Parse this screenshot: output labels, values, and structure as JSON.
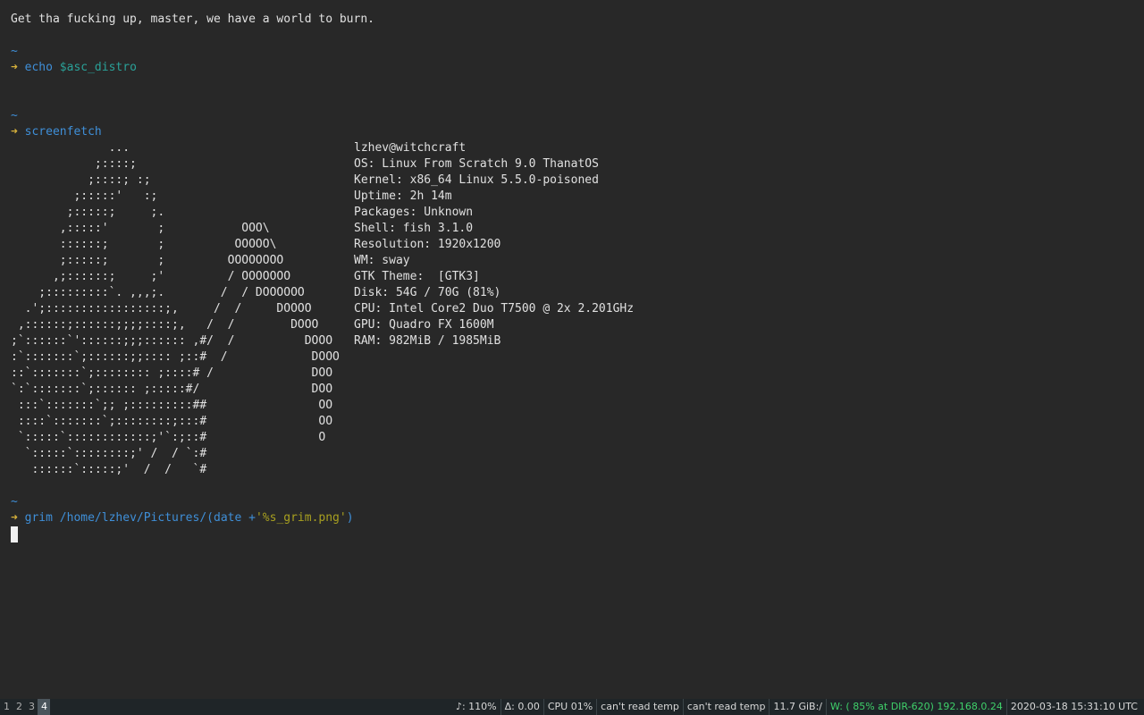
{
  "terminal": {
    "greeting": "Get tha fucking up, master, we have a world to burn.",
    "prompt": {
      "tilde": "~",
      "arrow": "➜"
    },
    "commands": {
      "echo": {
        "name": "echo",
        "arg": "$asc_distro"
      },
      "screenfetch": {
        "name": "screenfetch"
      },
      "grim": {
        "name": "grim",
        "path": "/home/lzhev/Pictures/",
        "paren_open": "(",
        "date_cmd": "date",
        "plus": "+",
        "format": "'%s_grim.png'",
        "paren_close": ")"
      }
    },
    "ascii_art": [
      "              ...",
      "            ;::::;",
      "           ;::::; :;",
      "         ;:::::'   :;",
      "        ;:::::;     ;.",
      "       ,:::::'       ;           OOO\\",
      "       ::::::;       ;          OOOOO\\",
      "       ;:::::;       ;         OOOOOOOO",
      "      ,;::::::;     ;'         / OOOOOOO",
      "    ;:::::::::`. ,,,;.        /  / DOOOOOO",
      "  .';:::::::::::::::::;,     /  /     DOOOO",
      " ,::::::;::::::;;;;::::;,   /  /        DOOO",
      ";`::::::`'::::::;;;:::::: ,#/  /          DOOO",
      ":`:::::::`;::::::;;:::: ;::#  /            DOOO",
      "::`:::::::`;:::::::: ;::::# /              DOO",
      "`:`:::::::`;:::::: ;:::::#/                DOO",
      " :::`:::::::`;; ;:::::::::##                OO",
      " ::::`:::::::`;::::::::;:::#                OO",
      " `:::::`::::::::::::;'`:;::#                O",
      "  `:::::`::::::::;' /  / `:#",
      "   ::::::`:::::;'  /  /   `#"
    ],
    "sysinfo": [
      "lzhev@witchcraft",
      "OS: Linux From Scratch 9.0 ThanatOS",
      "Kernel: x86_64 Linux 5.5.0-poisoned",
      "Uptime: 2h 14m",
      "Packages: Unknown",
      "Shell: fish 3.1.0",
      "Resolution: 1920x1200",
      "WM: sway",
      "GTK Theme:  [GTK3]",
      "Disk: 54G / 70G (81%)",
      "CPU: Intel Core2 Duo T7500 @ 2x 2.201GHz",
      "GPU: Quadro FX 1600M",
      "RAM: 982MiB / 1985MiB"
    ]
  },
  "bar": {
    "workspaces": [
      {
        "label": "1",
        "focused": false
      },
      {
        "label": "2",
        "focused": false
      },
      {
        "label": "3",
        "focused": false
      },
      {
        "label": "4",
        "focused": true
      }
    ],
    "status": {
      "volume": "♪: 110%",
      "load": "Δ: 0.00",
      "cpu": "CPU 01%",
      "temp1": "can't read temp",
      "temp2": "can't read temp",
      "disk": "11.7 GiB:/",
      "wifi": "W: ( 85% at DIR-620) 192.168.0.24",
      "datetime": "2020-03-18 15:31:10 UTC"
    },
    "colors": {
      "background": "#1f2528",
      "wifi_ok": "#3fd06a",
      "focused_ws": "#4a555c"
    }
  }
}
